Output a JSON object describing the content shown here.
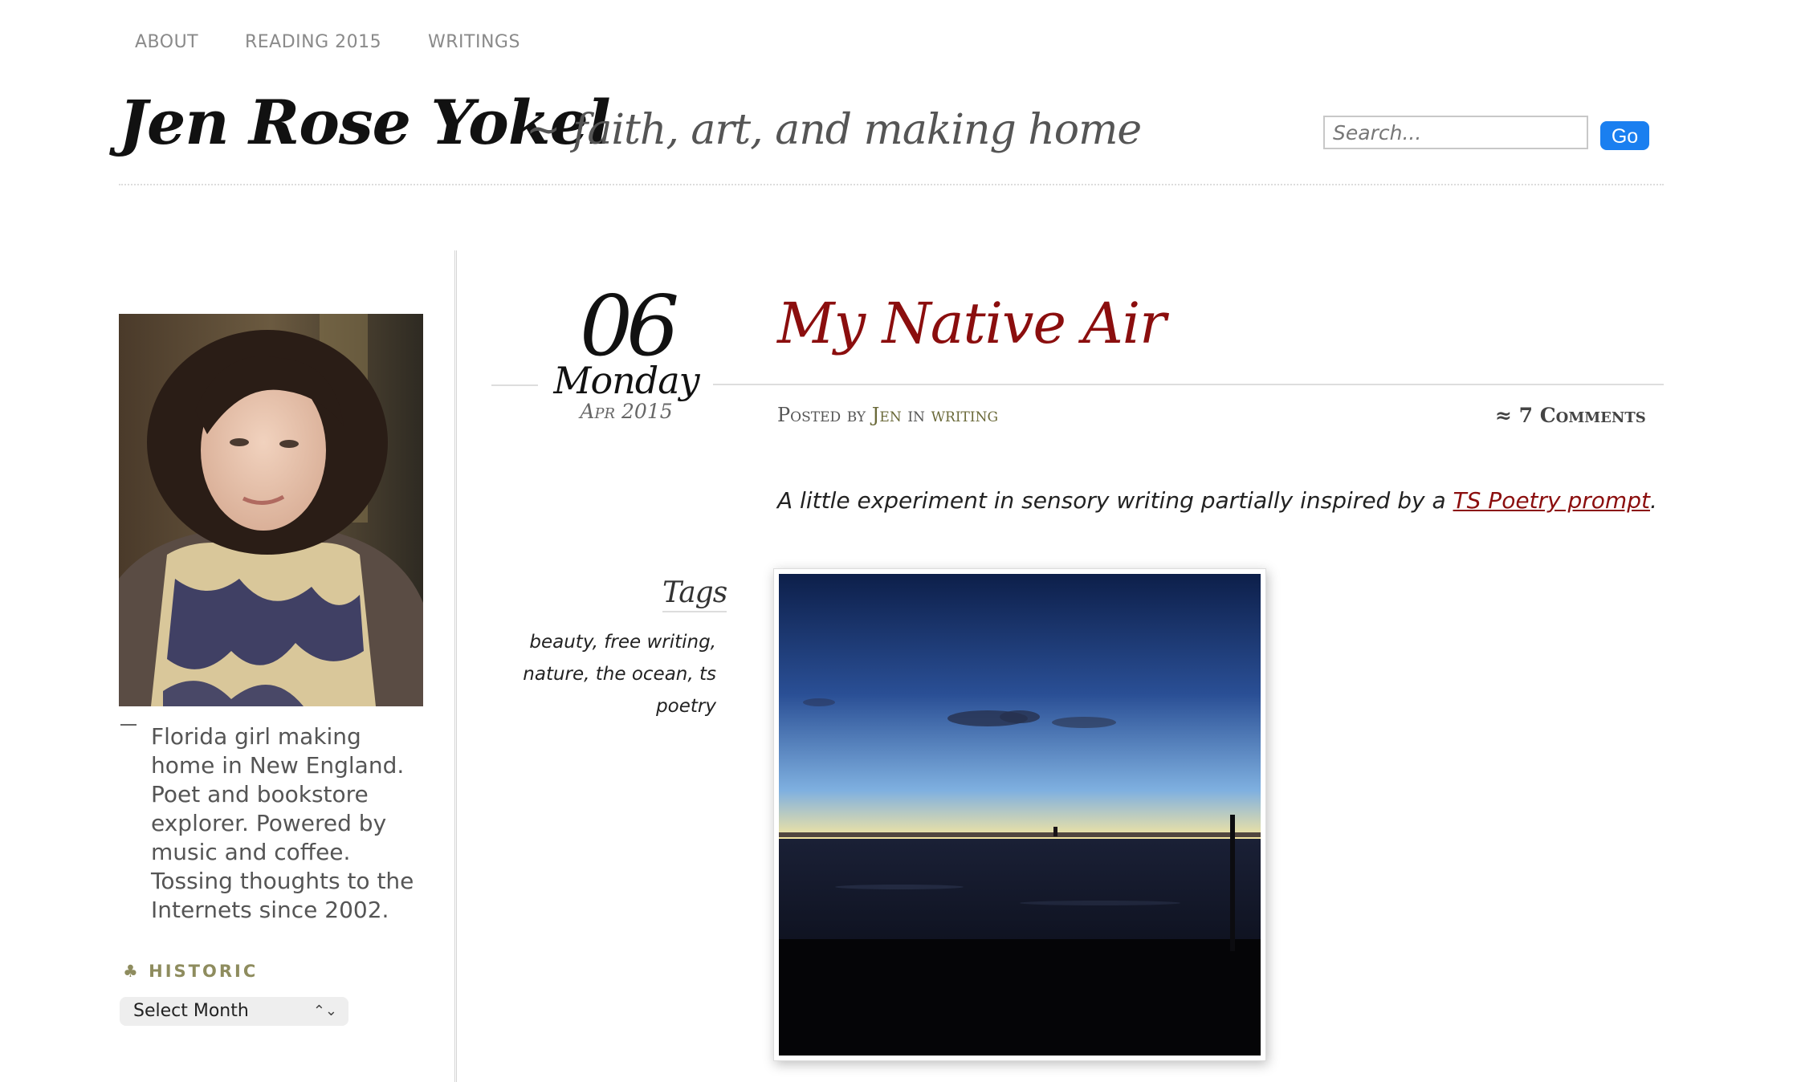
{
  "nav": {
    "items": [
      {
        "label": "ABOUT"
      },
      {
        "label": "READING 2015"
      },
      {
        "label": "WRITINGS"
      }
    ]
  },
  "header": {
    "site_title": "Jen Rose Yokel",
    "tagline": "~ faith, art, and making home",
    "search_placeholder": "Search...",
    "search_button": "Go"
  },
  "sidebar": {
    "bio": "Florida girl making home in New England. Poet and bookstore explorer. Powered by music and coffee. Tossing thoughts to the Internets since 2002.",
    "historic_heading": "HISTORIC",
    "historic_icon": "club-icon",
    "month_select": "Select Month"
  },
  "post": {
    "date_day": "06",
    "date_weekday": "Monday",
    "date_month": "Apr 2015",
    "title": "My Native Air",
    "meta_posted_by": "Posted by ",
    "meta_author": "Jen",
    "meta_in": " in ",
    "meta_category": "writing",
    "comments": "≈ 7 Comments",
    "intro_text": "A little experiment in sensory writing partially inspired by a ",
    "intro_link": "TS Poetry prompt",
    "intro_end": ".",
    "tags_heading": "Tags",
    "tags": "beauty, free writing, nature, the ocean, ts poetry"
  },
  "colors": {
    "accent_red": "#8b0e0e",
    "go_button": "#1a7ff0",
    "historic_olive": "#8e8c5e"
  }
}
